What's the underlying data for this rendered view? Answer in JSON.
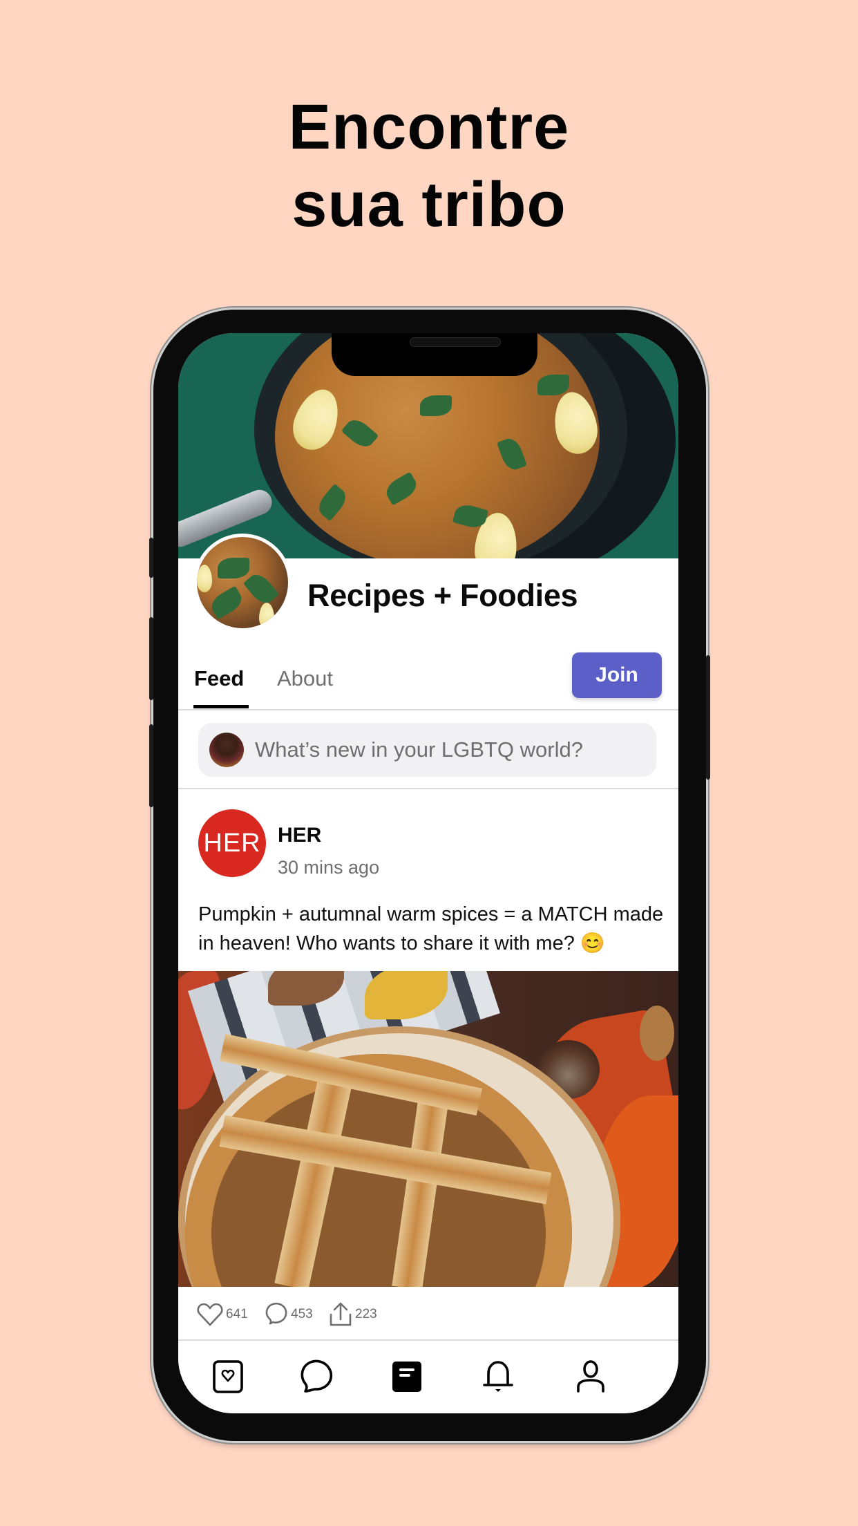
{
  "headline": {
    "line1": "Encontre",
    "line2": "sua tribo"
  },
  "group": {
    "title": "Recipes + Foodies",
    "cover_image": "paella-pan-photo",
    "avatar_image": "paella-photo"
  },
  "tabs": [
    {
      "label": "Feed",
      "active": true
    },
    {
      "label": "About",
      "active": false
    }
  ],
  "join_button": {
    "label": "Join",
    "color": "#5b5fc7"
  },
  "compose": {
    "placeholder": "What’s new in your LGBTQ world?",
    "avatar": "user-avatar"
  },
  "post": {
    "avatar_text": "HER",
    "avatar_color": "#d9281f",
    "author": "HER",
    "time": "30 mins ago",
    "body": "Pumpkin + autumnal warm spices = a MATCH made in heaven! Who wants to share it with me? 😊",
    "image": "pumpkin-pie-photo",
    "likes": "641",
    "comments": "453",
    "shares": "223"
  },
  "bottom_nav": [
    {
      "name": "matches",
      "icon": "heart-card-icon",
      "active": false
    },
    {
      "name": "chats",
      "icon": "chat-bubble-icon",
      "active": false
    },
    {
      "name": "feed",
      "icon": "feed-icon",
      "active": true
    },
    {
      "name": "notifications",
      "icon": "bell-icon",
      "active": false
    },
    {
      "name": "profile",
      "icon": "person-icon",
      "active": false
    }
  ],
  "colors": {
    "background": "#ffd6c2",
    "cover_green": "#176552",
    "accent": "#5b5fc7",
    "brand_red": "#d9281f"
  }
}
